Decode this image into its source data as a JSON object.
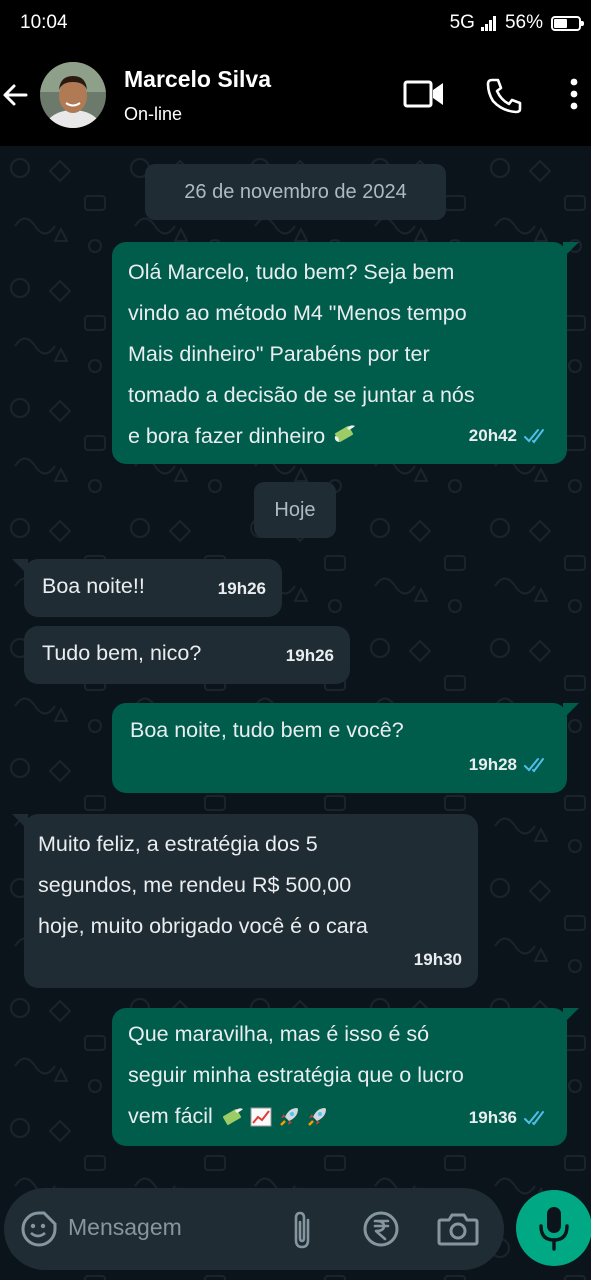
{
  "status_bar": {
    "time": "10:04",
    "network": "5G",
    "battery": "56%",
    "battery_level": 0.56
  },
  "header": {
    "name": "Marcelo Silva",
    "status": "On-line"
  },
  "messages": [
    {
      "kind": "date",
      "text": "26 de novembro de 2024"
    },
    {
      "kind": "out",
      "text": "Olá Marcelo, tudo bem? Seja bem\nvindo ao método M4 \"Menos tempo\nMais dinheiro\" Parabéns por ter\ntomado a decisão de se juntar a nós\ne bora fazer dinheiro",
      "time": "20h42",
      "emojis": [
        "money-with-wings-emoji"
      ]
    },
    {
      "kind": "date",
      "text": "Hoje"
    },
    {
      "kind": "in",
      "text": "Boa noite!!",
      "time": "19h26"
    },
    {
      "kind": "in",
      "text": "Tudo bem, nico?",
      "time": "19h26"
    },
    {
      "kind": "out",
      "text": "Boa noite, tudo bem e você?",
      "time": "19h28"
    },
    {
      "kind": "in",
      "text": "Muito feliz, a estratégia dos 5\nsegundos, me rendeu R$ 500,00\nhoje, muito obrigado você é o cara",
      "time": "19h30"
    },
    {
      "kind": "out",
      "text": "Que maravilha, mas é isso é só\nseguir minha estratégia que o lucro\nvem fácil",
      "time": "19h36",
      "emojis": [
        "money-with-wings-emoji",
        "chart-increasing-emoji",
        "rocket-emoji",
        "rocket-emoji"
      ]
    }
  ],
  "input": {
    "placeholder": "Mensagem"
  },
  "colors": {
    "background": "#0b141a",
    "outgoing_bubble": "#005c4b",
    "incoming_bubble": "#202c33",
    "accent": "#00a884",
    "read_ticks": "#53bdeb"
  }
}
